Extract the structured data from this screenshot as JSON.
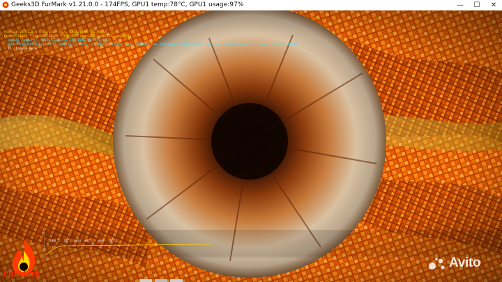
{
  "window": {
    "title": "Geeks3D FurMark v1.21.0.0 - 174FPS, GPU1 temp:78°C, GPU1 usage:97%",
    "minimize_glyph": "—",
    "maximize_glyph": "☐",
    "close_glyph": "✕"
  },
  "overlay": {
    "line1": "FurMark v1.21.0.0 - Burn-in test, 1920x1080 (0X MSAA)",
    "line2": "Frames:61525 - time:00:05:59 - FPS:174 (min:164, max:175, avg:171)",
    "line3": "- OpenGL renderer: NVIDIA GeForce GTX 1080 Ti/PCIe/SSE2",
    "line4": "- GPU 1 (NVIDIA GeForce GTX 1080 Ti) - core: 1746MHz/78°C/98%, mem: 5505MHz/13%, GPU power: 101.2% TDP, fan: 64%, limits:[power:1, temp:0, volt:0, OV:0]",
    "line5": "- F1: toggle help"
  },
  "graph": {
    "label": "GPU 1: 78°C (min: 48°C - max: 78°C)",
    "line_color": "#ffd000"
  },
  "logo": {
    "text": "FurMark",
    "icon": "flame-icon"
  },
  "watermark": {
    "text": "Avito",
    "icon": "avito-dots-icon"
  }
}
